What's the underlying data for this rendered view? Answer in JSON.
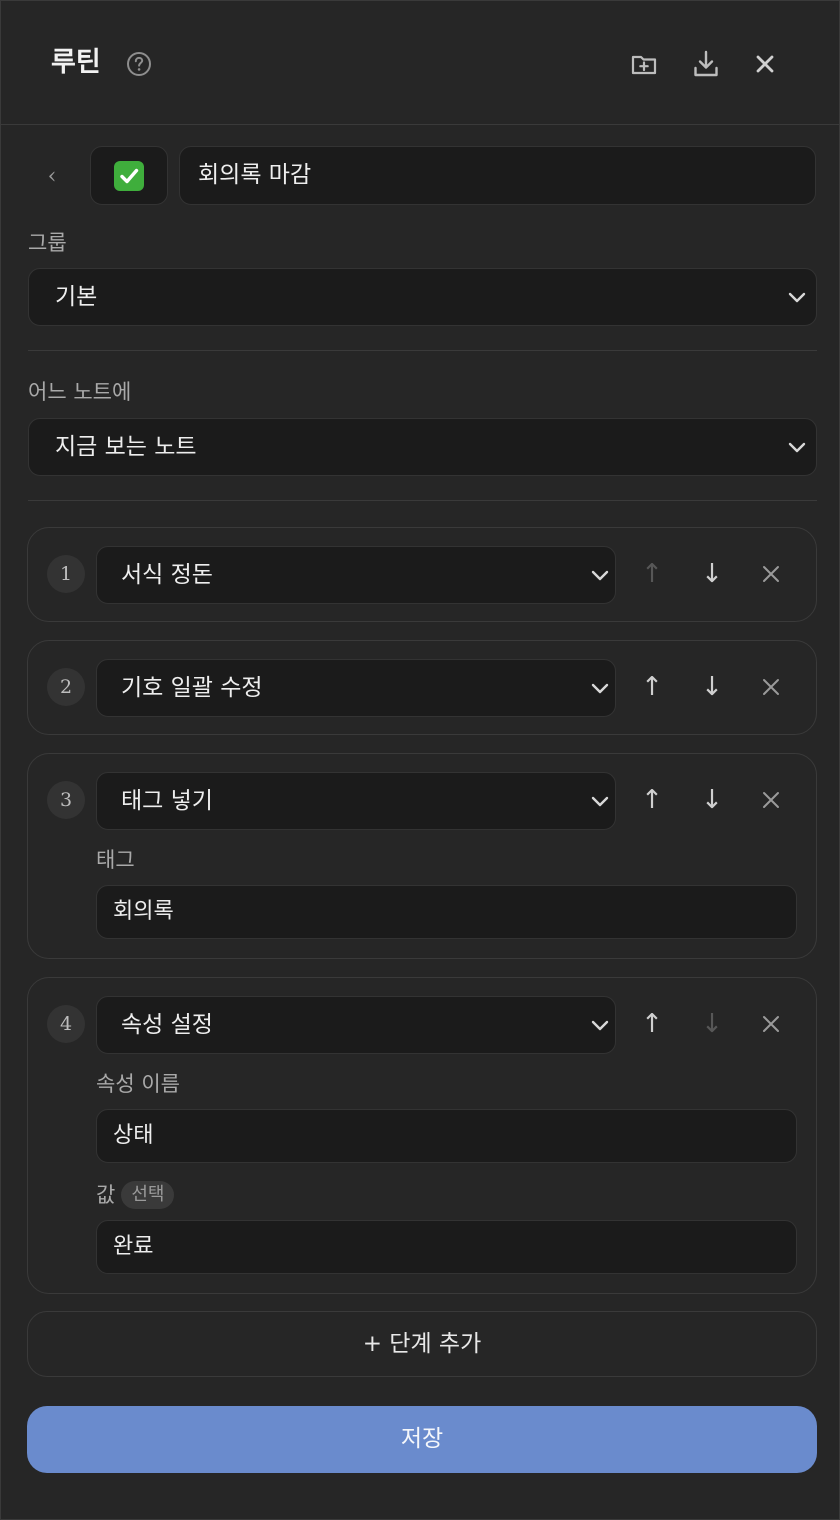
{
  "header": {
    "title": "루틴",
    "help_icon": "question-circle-icon",
    "actions": [
      "new-folder-icon",
      "download-icon",
      "close-icon"
    ]
  },
  "routine": {
    "back_icon": "‹",
    "emoji": "✅",
    "name": "회의록 마감"
  },
  "group": {
    "label": "그룹",
    "value": "기본"
  },
  "target": {
    "label": "어느 노트에",
    "value": "지금 보는 노트"
  },
  "steps": [
    {
      "number": "1",
      "action": "서식 정돈",
      "up_enabled": false,
      "down_enabled": true
    },
    {
      "number": "2",
      "action": "기호 일괄 수정",
      "up_enabled": true,
      "down_enabled": true
    },
    {
      "number": "3",
      "action": "태그 넣기",
      "up_enabled": true,
      "down_enabled": true,
      "fields": [
        {
          "label": "태그",
          "value": "회의록"
        }
      ]
    },
    {
      "number": "4",
      "action": "속성 설정",
      "up_enabled": true,
      "down_enabled": false,
      "fields": [
        {
          "label": "속성 이름",
          "value": "상태"
        },
        {
          "label": "값",
          "badge": "선택",
          "value": "완료"
        }
      ]
    }
  ],
  "arrows": {
    "up": "↑",
    "down": "↓"
  },
  "add_step_label": "+ 단계 추가",
  "save_label": "저장",
  "colors": {
    "background": "#262626",
    "input": "#1b1b1b",
    "accent": "#6a8bcd",
    "emoji_green": "#3fae3c"
  }
}
